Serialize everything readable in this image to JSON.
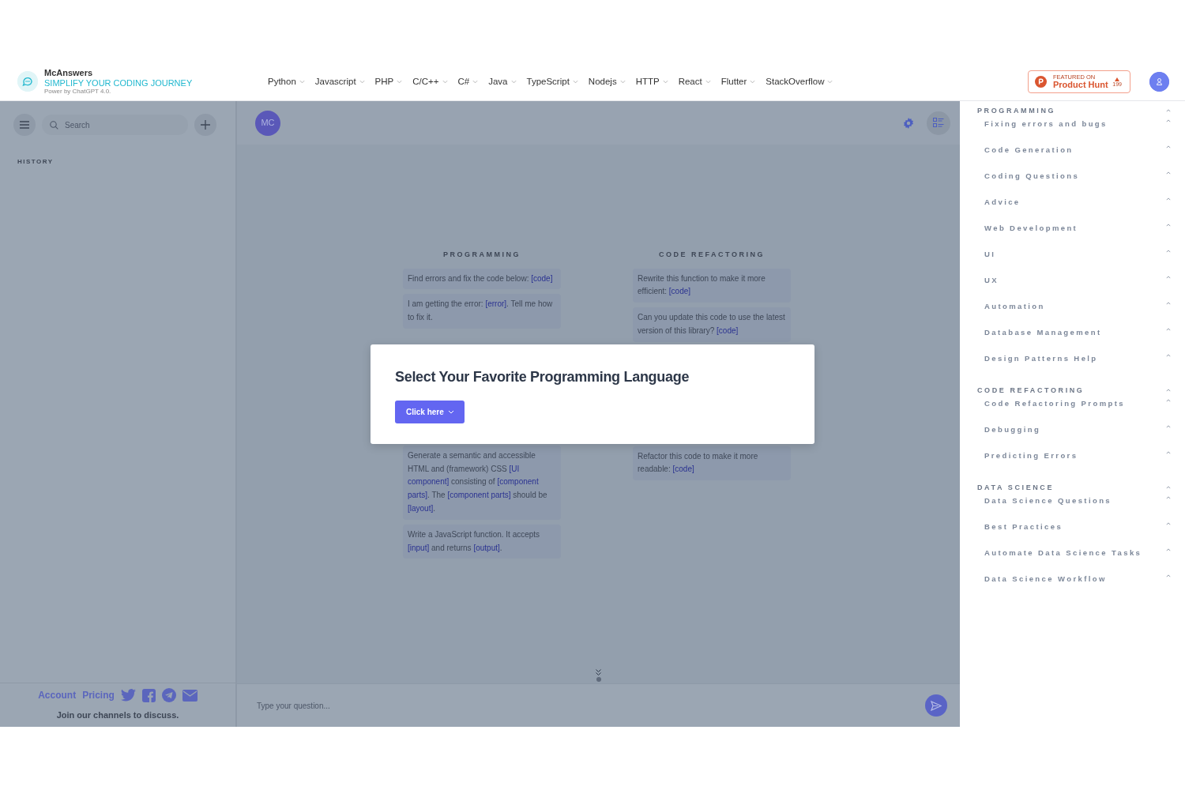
{
  "brand": {
    "name": "McAnswers",
    "tagline": "SIMPLIFY YOUR CODING JOURNEY",
    "subtitle": "Power by ChatGPT 4.0."
  },
  "nav": [
    {
      "label": "Python"
    },
    {
      "label": "Javascript"
    },
    {
      "label": "PHP"
    },
    {
      "label": "C/C++"
    },
    {
      "label": "C#"
    },
    {
      "label": "Java"
    },
    {
      "label": "TypeScript"
    },
    {
      "label": "Nodejs"
    },
    {
      "label": "HTTP"
    },
    {
      "label": "React"
    },
    {
      "label": "Flutter"
    },
    {
      "label": "StackOverflow"
    }
  ],
  "product_hunt": {
    "eyebrow": "FEATURED ON",
    "name": "Product Hunt",
    "votes": "199"
  },
  "sidebar": {
    "search_placeholder": "Search",
    "section": "HISTORY",
    "footer_links": [
      "Account",
      "Pricing"
    ],
    "footer_note": "Join our channels to discuss."
  },
  "chat": {
    "avatar": "MC",
    "input_placeholder": "Type your question...",
    "columns": [
      {
        "title": "PROGRAMMING",
        "prompts": [
          {
            "text": "Find errors and fix the code below: **[code]**"
          },
          {
            "text": "I am getting the error: **[error]**. Tell me how to fix it."
          },
          {
            "text": "Generate a semantic and accessible HTML and (framework) CSS **[UI component]** consisting of **[component parts]**. The **[component parts]** should be **[layout]**."
          },
          {
            "text": "Write a JavaScript function. It accepts **[input]** and returns **[output]**."
          }
        ]
      },
      {
        "title": "CODE REFACTORING",
        "prompts": [
          {
            "text": "Rewrite this function to make it more efficient: **[code]**"
          },
          {
            "text": "Can you update this code to use the latest version of this library? **[code]**"
          },
          {
            "text": "Refactor this code to make it more readable: **[code]**"
          }
        ]
      }
    ]
  },
  "modal": {
    "title": "Select Your Favorite Programming Language",
    "button": "Click here"
  },
  "categories": [
    {
      "title": "PROGRAMMING",
      "items": [
        {
          "label": "Fixing errors and bugs"
        },
        {
          "label": "Code Generation"
        },
        {
          "label": "Coding Questions"
        },
        {
          "label": "Advice"
        },
        {
          "label": "Web Development"
        },
        {
          "label": "UI"
        },
        {
          "label": "UX"
        },
        {
          "label": "Automation"
        },
        {
          "label": "Database Management"
        },
        {
          "label": "Design Patterns Help"
        }
      ]
    },
    {
      "title": "CODE REFACTORING",
      "items": [
        {
          "label": "Code Refactoring Prompts"
        },
        {
          "label": "Debugging"
        },
        {
          "label": "Predicting Errors"
        }
      ]
    },
    {
      "title": "DATA SCIENCE",
      "items": [
        {
          "label": "Data Science Questions"
        },
        {
          "label": "Best Practices"
        },
        {
          "label": "Automate Data Science Tasks"
        },
        {
          "label": "Data Science Workflow"
        }
      ]
    }
  ]
}
